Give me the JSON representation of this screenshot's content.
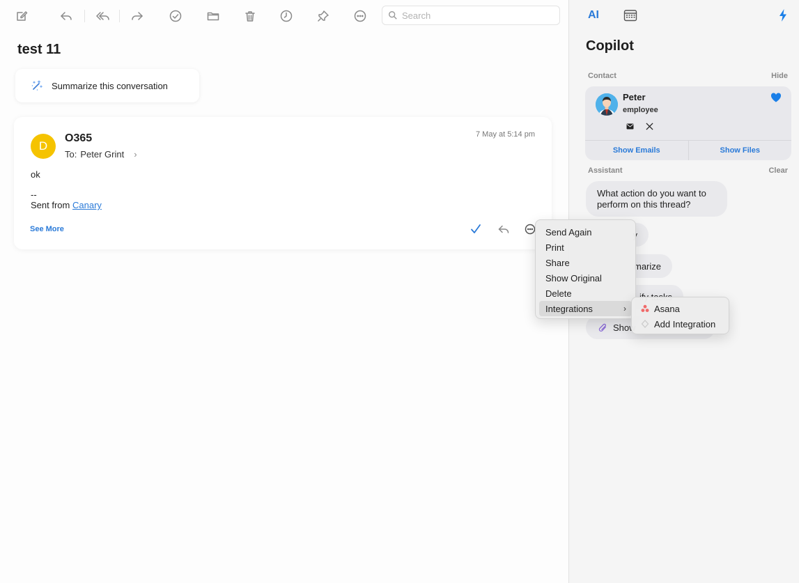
{
  "toolbar": {
    "search_placeholder": "Search",
    "icons": [
      "compose-icon",
      "reply-icon",
      "reply-all-icon",
      "forward-icon",
      "done-icon",
      "folder-icon",
      "trash-icon",
      "snooze-icon",
      "pin-icon",
      "more-icon"
    ]
  },
  "thread": {
    "subject": "test 11",
    "summarize_label": "Summarize this conversation"
  },
  "message": {
    "avatar_initial": "D",
    "avatar_color": "#f5c300",
    "sender": "O365",
    "to_prefix": "To:",
    "to_name": "Peter Grint",
    "date": "7 May at 5:14 pm",
    "body_line1": "ok",
    "signature_sep": "--",
    "sent_from_prefix": "Sent from",
    "sent_from_link": "Canary",
    "see_more": "See More"
  },
  "context_menu": {
    "items": [
      "Send Again",
      "Print",
      "Share",
      "Show Original",
      "Delete",
      "Integrations"
    ],
    "arrow": "›"
  },
  "integrations_submenu": {
    "items": [
      "Asana",
      "Add Integration"
    ]
  },
  "sidebar": {
    "tab_ai": "AI",
    "title": "Copilot",
    "contact_label": "Contact",
    "contact_hide": "Hide",
    "contact": {
      "name": "Peter",
      "role": "employee",
      "show_emails": "Show Emails",
      "show_files": "Show Files"
    },
    "assistant_label": "Assistant",
    "assistant_clear": "Clear",
    "assistant_question": "What action do you want to perform on this thread?",
    "suggestions_visible": [
      "y",
      "marize",
      "ify tasks",
      "Show"
    ]
  },
  "colors": {
    "accent": "#2a7ad8",
    "heart": "#1a7fe8",
    "asana": "#f06a6a"
  }
}
